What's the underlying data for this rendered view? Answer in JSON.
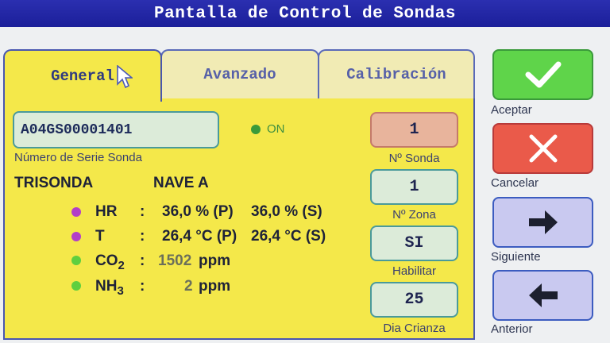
{
  "window": {
    "title": "Pantalla de Control de Sondas"
  },
  "tabs": [
    {
      "label": "General",
      "active": true
    },
    {
      "label": "Avanzado",
      "active": false
    },
    {
      "label": "Calibración",
      "active": false
    }
  ],
  "serial": {
    "value": "A04GS00001401",
    "label": "Número de Serie Sonda"
  },
  "status": {
    "text": "ON",
    "color": "#3a9a3a"
  },
  "device": {
    "type": "TRISONDA",
    "location": "NAVE A"
  },
  "readings": [
    {
      "name": "HR",
      "sub": "",
      "sep": ":",
      "value1": "36,0 % (P)",
      "value2": "36,0 % (S)",
      "dot_color": "#b23fc8"
    },
    {
      "name": "T",
      "sub": "",
      "sep": ":",
      "value1": "26,4 °C (P)",
      "value2": "26,4 °C (S)",
      "dot_color": "#b23fc8"
    },
    {
      "name": "CO",
      "sub": "2",
      "sep": ":",
      "num": "1502",
      "unit": "ppm",
      "dot_color": "#5fcf3f"
    },
    {
      "name": "NH",
      "sub": "3",
      "sep": ":",
      "num": "2",
      "unit": "ppm",
      "dot_color": "#5fcf3f"
    }
  ],
  "right_fields": [
    {
      "value": "1",
      "label": "Nº Sonda",
      "bg": "#e8b49c"
    },
    {
      "value": "1",
      "label": "Nº Zona",
      "bg": "#dcebd9"
    },
    {
      "value": "SI",
      "label": "Habilitar",
      "bg": "#dcebd9"
    },
    {
      "value": "25",
      "label": "Dia Crianza",
      "bg": "#dcebd9"
    }
  ],
  "actions": [
    {
      "label": "Aceptar",
      "icon": "check-icon",
      "bg": "#5fd44a"
    },
    {
      "label": "Cancelar",
      "icon": "close-icon",
      "bg": "#ea5a4a"
    },
    {
      "label": "Siguiente",
      "icon": "arrow-right-icon",
      "bg": "#c9c9f0"
    },
    {
      "label": "Anterior",
      "icon": "arrow-left-icon",
      "bg": "#c9c9f0"
    }
  ]
}
